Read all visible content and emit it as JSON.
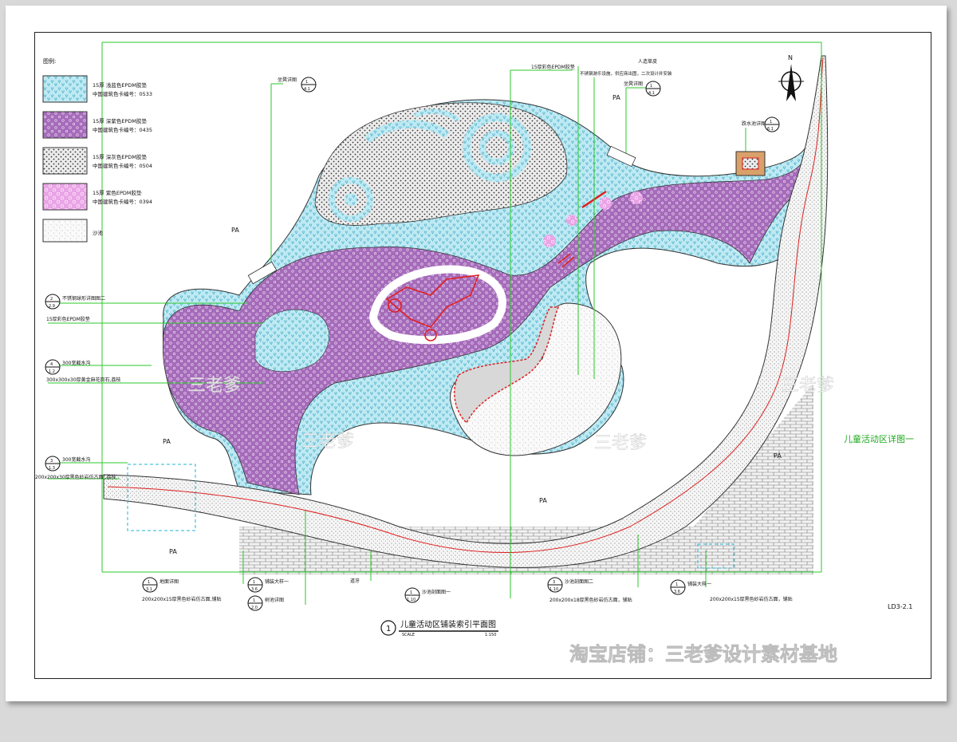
{
  "legend": {
    "title": "图例:",
    "items": [
      {
        "line1": "15厚 浅蓝色EPDM胶垫",
        "line2": "中国建筑色卡编号：0533",
        "swatch": "cyan"
      },
      {
        "line1": "15厚 深紫色EPDM胶垫",
        "line2": "中国建筑色卡编号：0435",
        "swatch": "purple"
      },
      {
        "line1": "15厚 深灰色EPDM胶垫",
        "line2": "中国建筑色卡编号：0504",
        "swatch": "grey"
      },
      {
        "line1": "15厚 紫色EPDM胶垫",
        "line2": "中国建筑色卡编号：0394",
        "swatch": "pink"
      },
      {
        "line1": "沙池",
        "line2": "",
        "swatch": "sand"
      }
    ]
  },
  "callouts": {
    "top_left_detail": {
      "label": "坐凳详图",
      "num": "1",
      "ref": "4.1"
    },
    "top_epdm": "15厚彩色EPDM胶垫",
    "top_right_note1": "人造草皮",
    "top_right_note2": "不锈钢游乐设施，供应商出图，二次设计并安装",
    "top_right_detail": {
      "label": "坐凳详图",
      "num": "1",
      "ref": "4.1"
    },
    "pool_detail": {
      "label": "跌水池详图",
      "num": "1",
      "ref": "6.1"
    },
    "left1": {
      "label": "不锈钢球形详图图二",
      "num": "2",
      "ref": "2.9"
    },
    "left2": "15厚彩色EPDM胶垫",
    "left3": {
      "label": "300宽截水沟",
      "num": "4",
      "ref": "1.2"
    },
    "left3b": "300x300x30厚黄金麻花岗石,荔枝",
    "left4": {
      "label": "300宽截水沟",
      "num": "3",
      "ref": "1.3"
    },
    "left4b": "200x200x30厚黑色砂岩仿古面 ,荔枝",
    "bottom1": {
      "label": "地面详图",
      "num": "1",
      "ref": "3.1"
    },
    "bottom1b": "200x200x15厚黑色砂岩仿古面,铺贴",
    "bottom2": {
      "label": "铺装大样一",
      "num": "1",
      "ref": "3.6"
    },
    "bottom3": {
      "label": "树池详图",
      "num": "1",
      "ref": "2.0"
    },
    "bottom4": "道牙",
    "bottom5": {
      "label": "沙池剖面图一",
      "num": "1",
      "ref": "1.10"
    },
    "bottom6": {
      "label": "沙池剖面图二",
      "num": "3",
      "ref": "1.10"
    },
    "bottom6b": "200x200x18厚黑色砂岩仿古面，铺贴",
    "bottom7": {
      "label": "铺装大样一",
      "num": "1",
      "ref": "3.6"
    },
    "bottom7b": "200x200x15厚黑色砂岩仿古面，铺贴"
  },
  "area_labels": [
    "PA",
    "PA",
    "PA",
    "PA",
    "PA",
    "PA"
  ],
  "north": "N",
  "side_title": "儿童活动区详图一",
  "sheet_no": "LD3-2.1",
  "title_block": {
    "num": "1",
    "title": "儿童活动区铺装索引平面图",
    "scale_label": "SCALE",
    "scale": "1:150"
  },
  "watermarks": [
    "三老爹",
    "三老爹",
    "三老爹",
    "三老爹"
  ],
  "shop_watermark": "淘宝店铺：三老爹设计素材基地",
  "colors": {
    "cyan": "#7fd6e8",
    "purple": "#9a5ab0",
    "pink": "#e79ae0",
    "grey": "#c8c8c8",
    "green": "#2bc82b",
    "red": "#e02020"
  }
}
